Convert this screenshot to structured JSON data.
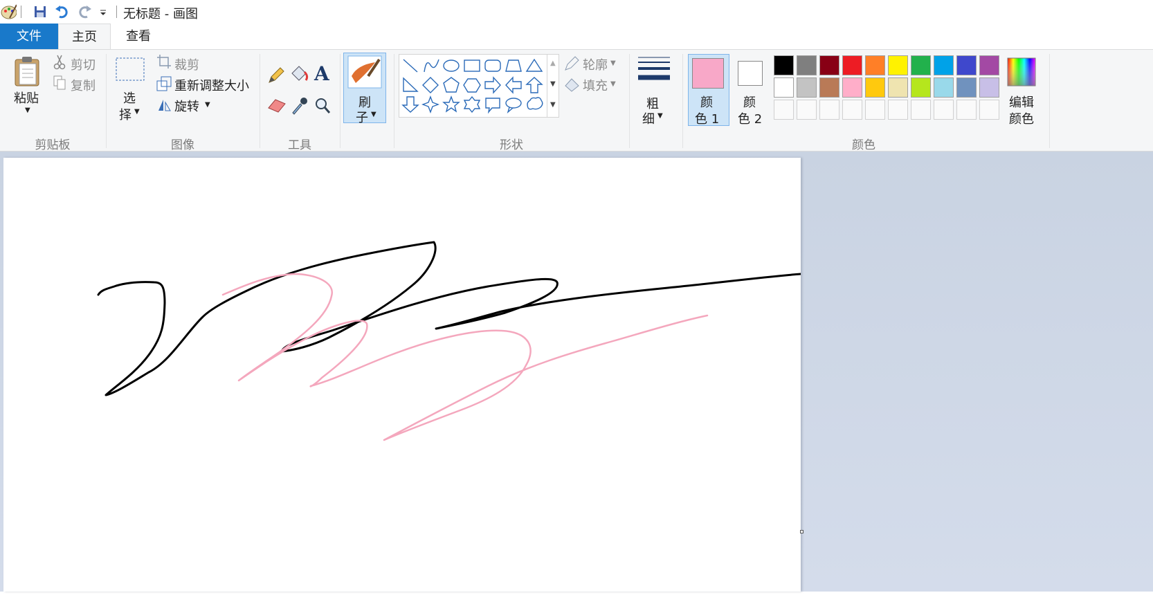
{
  "window": {
    "title": "无标题 - 画图"
  },
  "tabs": [
    {
      "label": "文件"
    },
    {
      "label": "主页"
    },
    {
      "label": "查看"
    }
  ],
  "ribbon": {
    "clipboard": {
      "group_label": "剪贴板",
      "paste": "粘贴",
      "cut": "剪切",
      "copy": "复制"
    },
    "image": {
      "group_label": "图像",
      "select_line1": "选",
      "select_line2": "择",
      "crop": "裁剪",
      "resize": "重新调整大小",
      "rotate": "旋转"
    },
    "tools": {
      "group_label": "工具"
    },
    "brushes": {
      "label_line1": "刷",
      "label_line2": "子"
    },
    "shapes": {
      "group_label": "形状",
      "outline": "轮廓",
      "fill": "填充"
    },
    "size": {
      "label_line1": "粗",
      "label_line2": "细"
    },
    "colors": {
      "group_label": "颜色",
      "color1_line1": "颜",
      "color1_line2": "色 1",
      "color2_line1": "颜",
      "color2_line2": "色 2",
      "edit_line1": "编辑",
      "edit_line2": "颜色",
      "color1_value": "#f8a8c8",
      "color2_value": "#ffffff",
      "palette_row1": [
        "#000000",
        "#7f7f7f",
        "#880015",
        "#ed1c24",
        "#ff7f27",
        "#fff200",
        "#22b14c",
        "#00a2e8",
        "#3f48cc",
        "#a349a4"
      ],
      "palette_row2": [
        "#ffffff",
        "#c3c3c3",
        "#b97a57",
        "#ffaec9",
        "#ffc90e",
        "#efe4b0",
        "#b5e61d",
        "#99d9ea",
        "#7092be",
        "#c8bfe7"
      ]
    }
  },
  "canvas": {
    "stroke_colors": {
      "black": "#000000",
      "pink": "#f4a7bd"
    }
  }
}
